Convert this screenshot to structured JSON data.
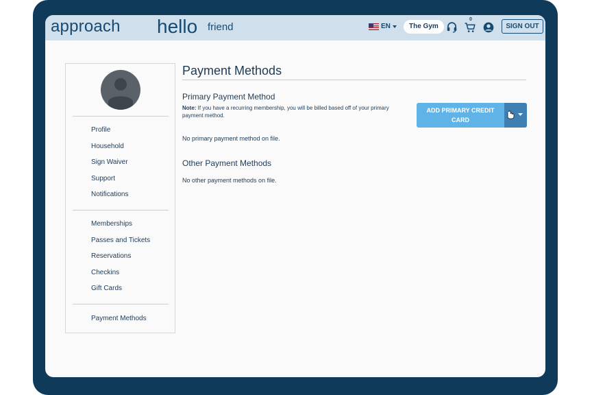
{
  "header": {
    "logo": "approach",
    "greeting": "hello",
    "user_name": "friend",
    "language": "EN",
    "gym_name": "The Gym",
    "cart_count": "0",
    "sign_out_label": "SIGN OUT"
  },
  "sidebar": {
    "group1": [
      "Profile",
      "Household",
      "Sign Waiver",
      "Support",
      "Notifications"
    ],
    "group2": [
      "Memberships",
      "Passes and Tickets",
      "Reservations",
      "Checkins",
      "Gift Cards"
    ],
    "group3": [
      "Payment Methods"
    ]
  },
  "main": {
    "title": "Payment Methods",
    "primary_heading": "Primary Payment Method",
    "note_label": "Note:",
    "note_text": " If you have a recurring membership, you will be billed based off of your primary payment method.",
    "primary_empty": "No primary payment method on file.",
    "other_heading": "Other Payment Methods",
    "other_empty": "No other payment methods on file.",
    "add_button_line1": "ADD PRIMARY CREDIT",
    "add_button_line2": "CARD"
  },
  "colors": {
    "frame": "#0f3a5a",
    "header_bg": "#cfe0ec",
    "button": "#5fb3e6",
    "button_dropdown": "#3f7fb2"
  }
}
